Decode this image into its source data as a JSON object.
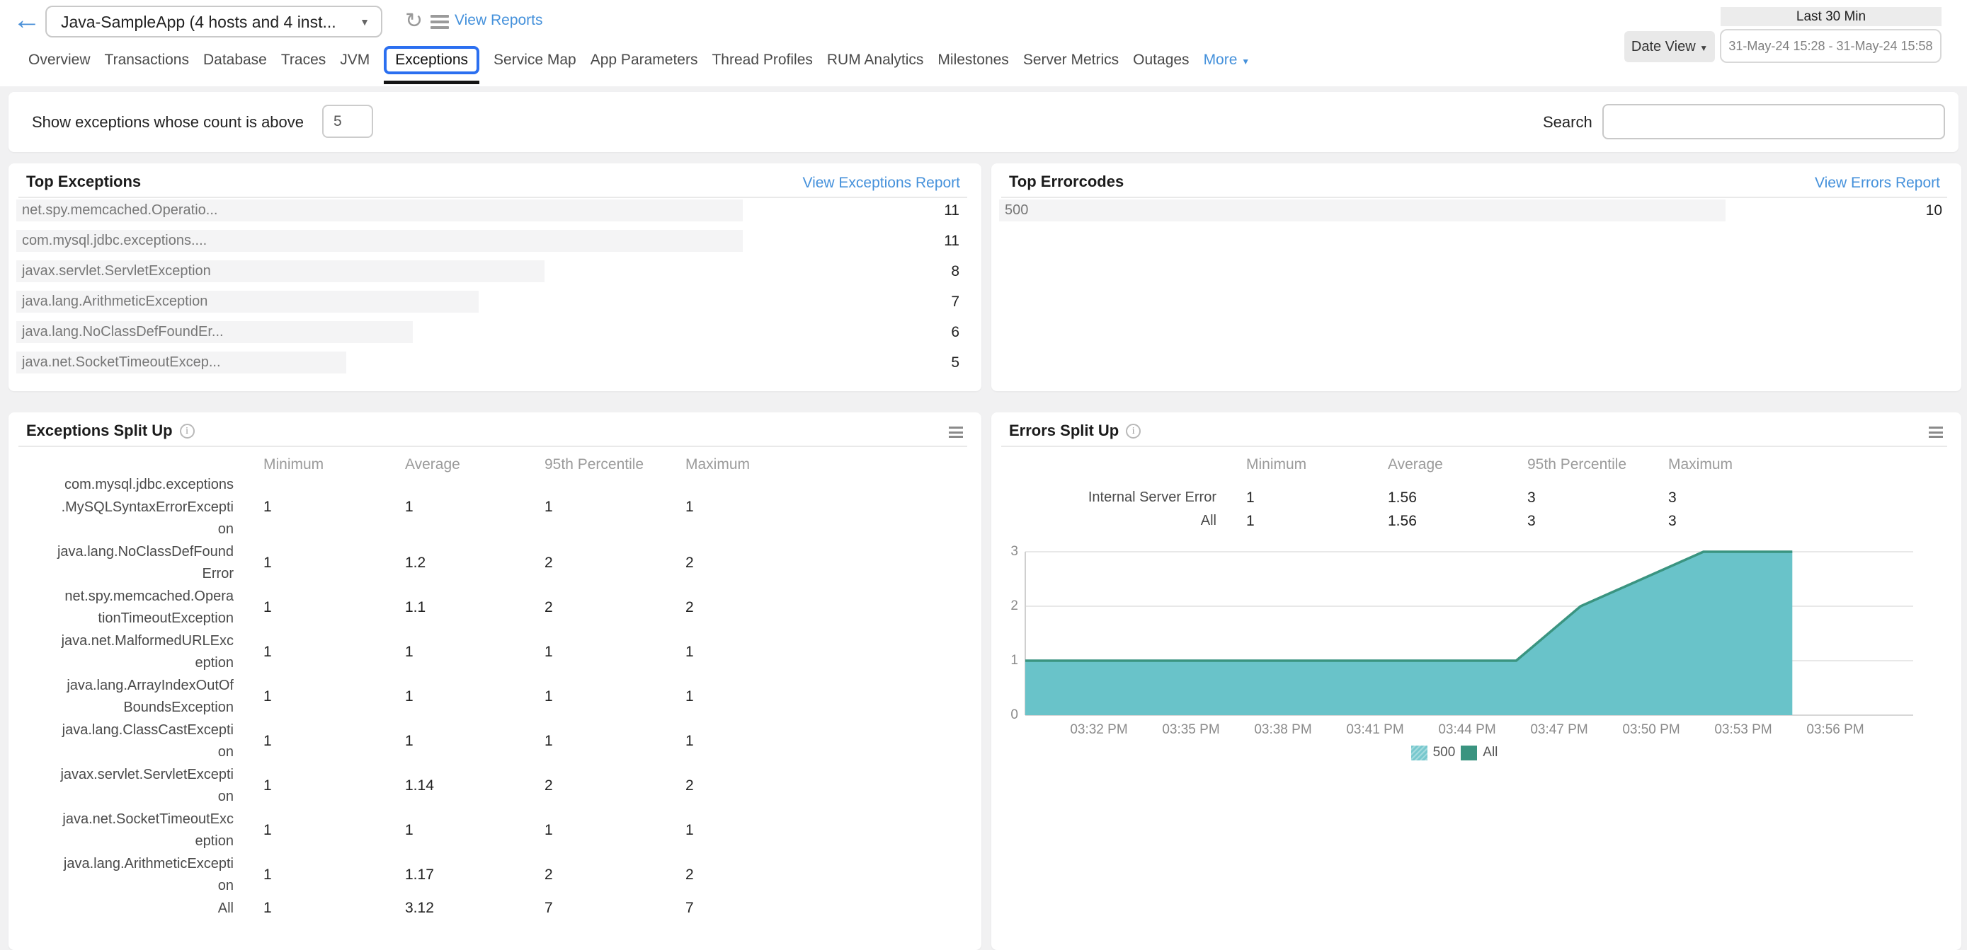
{
  "header": {
    "app_selector_value": "Java-SampleApp (4 hosts and 4 inst...",
    "view_reports_label": "View Reports",
    "time_range_label": "Last 30 Min",
    "date_view_label": "Date View",
    "date_range_value": "31-May-24 15:28 - 31-May-24 15:58"
  },
  "tabs": {
    "items": [
      "Overview",
      "Transactions",
      "Database",
      "Traces",
      "JVM",
      "Exceptions",
      "Service Map",
      "App Parameters",
      "Thread Profiles",
      "RUM Analytics",
      "Milestones",
      "Server Metrics",
      "Outages"
    ],
    "selected": "Exceptions",
    "more_label": "More"
  },
  "filter": {
    "label": "Show exceptions whose count is above",
    "count_value": "5",
    "search_label": "Search",
    "search_value": ""
  },
  "top_exceptions": {
    "title": "Top Exceptions",
    "link": "View Exceptions Report",
    "rows": [
      {
        "name": "net.spy.memcached.Operatio...",
        "count": 11
      },
      {
        "name": "com.mysql.jdbc.exceptions....",
        "count": 11
      },
      {
        "name": "javax.servlet.ServletException",
        "count": 8
      },
      {
        "name": "java.lang.ArithmeticException",
        "count": 7
      },
      {
        "name": "java.lang.NoClassDefFoundEr...",
        "count": 6
      },
      {
        "name": "java.net.SocketTimeoutExcep...",
        "count": 5
      }
    ]
  },
  "top_errorcodes": {
    "title": "Top Errorcodes",
    "link": "View Errors Report",
    "rows": [
      {
        "name": "500",
        "count": 10
      }
    ]
  },
  "exceptions_split": {
    "title": "Exceptions Split Up",
    "columns": [
      "Minimum",
      "Average",
      "95th Percentile",
      "Maximum"
    ],
    "rows": [
      {
        "name": "com.mysql.jdbc.exceptions\n.MySQLSyntaxErrorExcepti\non",
        "values": [
          "1",
          "1",
          "1",
          "1"
        ]
      },
      {
        "name": "java.lang.NoClassDefFound\nError",
        "values": [
          "1",
          "1.2",
          "2",
          "2"
        ]
      },
      {
        "name": "net.spy.memcached.Opera\ntionTimeoutException",
        "values": [
          "1",
          "1.1",
          "2",
          "2"
        ]
      },
      {
        "name": "java.net.MalformedURLExc\neption",
        "values": [
          "1",
          "1",
          "1",
          "1"
        ]
      },
      {
        "name": "java.lang.ArrayIndexOutOf\nBoundsException",
        "values": [
          "1",
          "1",
          "1",
          "1"
        ]
      },
      {
        "name": "java.lang.ClassCastExcepti\non",
        "values": [
          "1",
          "1",
          "1",
          "1"
        ]
      },
      {
        "name": "javax.servlet.ServletExcepti\non",
        "values": [
          "1",
          "1.14",
          "2",
          "2"
        ]
      },
      {
        "name": "java.net.SocketTimeoutExc\neption",
        "values": [
          "1",
          "1",
          "1",
          "1"
        ]
      },
      {
        "name": "java.lang.ArithmeticExcepti\non",
        "values": [
          "1",
          "1.17",
          "2",
          "2"
        ]
      },
      {
        "name": "All",
        "values": [
          "1",
          "3.12",
          "7",
          "7"
        ]
      }
    ]
  },
  "errors_split": {
    "title": "Errors Split Up",
    "columns": [
      "Minimum",
      "Average",
      "95th Percentile",
      "Maximum"
    ],
    "rows": [
      {
        "name": "Internal Server Error",
        "values": [
          "1",
          "1.56",
          "3",
          "3"
        ]
      },
      {
        "name": "All",
        "values": [
          "1",
          "1.56",
          "3",
          "3"
        ]
      }
    ]
  },
  "chart_data": {
    "type": "area",
    "title": "Errors Split Up",
    "x_unit": "minutes after 3:00 PM",
    "x_ticks": [
      "03:32 PM",
      "03:35 PM",
      "03:38 PM",
      "03:41 PM",
      "03:44 PM",
      "03:47 PM",
      "03:50 PM",
      "03:53 PM",
      "03:56 PM"
    ],
    "x_tick_minutes": [
      32,
      35,
      38,
      41,
      44,
      47,
      50,
      53,
      56
    ],
    "ylim": [
      0,
      3
    ],
    "y_ticks": [
      0,
      1,
      2,
      3
    ],
    "legend_position": "bottom",
    "series": [
      {
        "name": "500",
        "fill_color": "#69c3c9",
        "points": [
          [
            29.6,
            1
          ],
          [
            45.6,
            1
          ],
          [
            47.7,
            2
          ],
          [
            51.7,
            3
          ],
          [
            54.6,
            3
          ]
        ]
      },
      {
        "name": "All",
        "line_color": "#3a9480",
        "points": [
          [
            29.6,
            1
          ],
          [
            45.6,
            1
          ],
          [
            47.7,
            2
          ],
          [
            51.7,
            3
          ],
          [
            54.6,
            3
          ]
        ]
      }
    ]
  }
}
